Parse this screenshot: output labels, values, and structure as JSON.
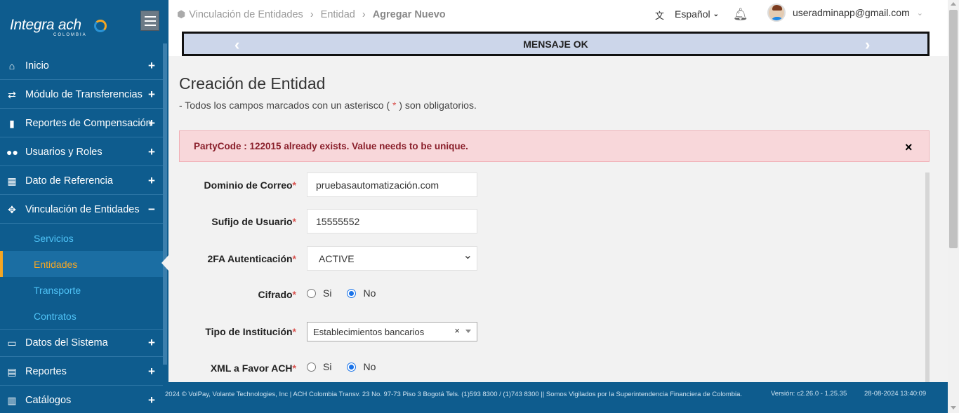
{
  "sidebar": {
    "logo_text": "Integra ach",
    "logo_sub": "COLOMBIA",
    "menu": [
      {
        "label": "Inicio",
        "icon": "home-icon",
        "glyph": "⌂",
        "toggle": "+"
      },
      {
        "label": "Módulo de Transferencias",
        "icon": "exchange-icon",
        "glyph": "⇄",
        "toggle": "+"
      },
      {
        "label": "Reportes de Compensación",
        "icon": "file-icon",
        "glyph": "▮",
        "toggle": "+"
      },
      {
        "label": "Usuarios y Roles",
        "icon": "users-icon",
        "glyph": "👥",
        "toggle": "+"
      },
      {
        "label": "Dato de Referencia",
        "icon": "calendar-icon",
        "glyph": "▦",
        "toggle": "+"
      },
      {
        "label": "Vinculación de Entidades",
        "icon": "crosshair-icon",
        "glyph": "✥",
        "toggle": "−"
      },
      {
        "label": "Datos del Sistema",
        "icon": "monitor-icon",
        "glyph": "▭",
        "toggle": "+"
      },
      {
        "label": "Reportes",
        "icon": "report-icon",
        "glyph": "▤",
        "toggle": "+"
      },
      {
        "label": "Catálogos",
        "icon": "catalog-icon",
        "glyph": "▥",
        "toggle": "+"
      }
    ],
    "submenu": [
      {
        "label": "Servicios"
      },
      {
        "label": "Entidades"
      },
      {
        "label": "Transporte"
      },
      {
        "label": "Contratos"
      }
    ]
  },
  "header": {
    "breadcrumb": [
      "Vinculación de Entidades",
      "Entidad",
      "Agregar Nuevo"
    ],
    "language": "Español",
    "user_email": "useradminapp@gmail.com"
  },
  "banner": {
    "text": "MENSAJE OK"
  },
  "page": {
    "title": "Creación de Entidad",
    "subtitle_prefix": "- Todos los campos marcados con un asterisco (",
    "subtitle_asterisk": "*",
    "subtitle_suffix": ") son obligatorios."
  },
  "alert": {
    "text": "PartyCode : 122015 already exists. Value needs to be unique.",
    "close": "×"
  },
  "form": {
    "asterisk": "*",
    "dominio": {
      "label": "Dominio de Correo",
      "value": "pruebasautomatización.com"
    },
    "sufijo": {
      "label": "Sufijo de Usuario",
      "value": "15555552"
    },
    "twofa": {
      "label": "2FA Autenticación",
      "value": "ACTIVE"
    },
    "cifrado": {
      "label": "Cifrado",
      "opt_yes": "Si",
      "opt_no": "No",
      "selected": "No"
    },
    "tipo": {
      "label": "Tipo de Institución",
      "value": "Establecimientos bancarios",
      "clear": "×"
    },
    "xml": {
      "label": "XML a Favor ACH",
      "opt_yes": "Si",
      "opt_no": "No",
      "selected": "No"
    }
  },
  "footer": {
    "text": "2024 © VolPay, Volante Technologies, Inc | ACH Colombia Transv. 23 No. 97-73 Piso 3 Bogotá Tels. (1)593 8300 / (1)743 8300 || Somos Vigilados por la Superintendencia Financiera de Colombia.",
    "version": "Versión: c2.26.0 - 1.25.35",
    "datetime": "28-08-2024 13:40:09"
  },
  "colors": {
    "sidebar": "#0e5c8e",
    "accent": "#f5a623",
    "submenu_text": "#4fc3f7",
    "alert_bg": "#f8d7da",
    "alert_text": "#8a1f2b",
    "banner_bg": "#ccd6ea"
  }
}
